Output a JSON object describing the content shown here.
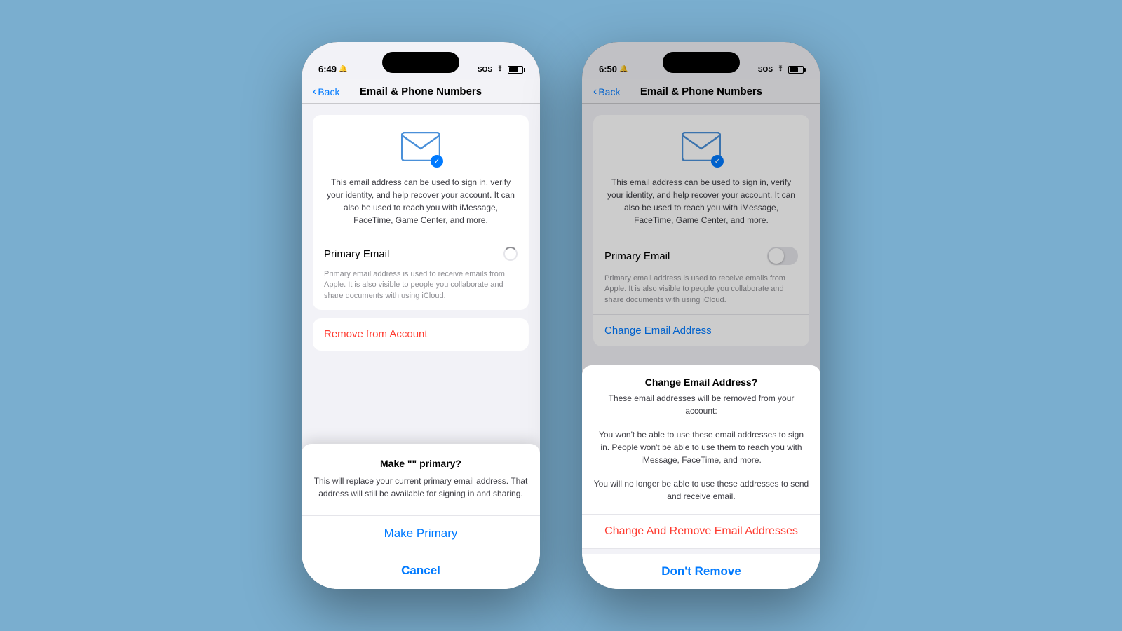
{
  "background_color": "#7aaecf",
  "phone_left": {
    "status": {
      "time": "6:49",
      "bell_icon": "🔔",
      "signal": "SOS",
      "wifi": true,
      "battery": 70
    },
    "nav": {
      "back_label": "Back",
      "title": "Email & Phone Numbers"
    },
    "card": {
      "description": "This email address can be used to sign in, verify your identity, and help recover your account. It can also be used to reach you with iMessage, FaceTime, Game Center, and more.",
      "primary_email_label": "Primary Email",
      "primary_email_sub": "Primary email address is used to receive emails from Apple. It is also visible to people you collaborate and share documents with using iCloud."
    },
    "remove_button": "Remove from Account",
    "sheet": {
      "title": "Make \"\" primary?",
      "body": "This will replace your current primary email address. That address will still be available for signing in and sharing.",
      "action_label": "Make Primary",
      "cancel_label": "Cancel"
    }
  },
  "phone_right": {
    "status": {
      "time": "6:50",
      "bell_icon": "🔔",
      "signal": "SOS",
      "wifi": true,
      "battery": 69
    },
    "nav": {
      "back_label": "Back",
      "title": "Email & Phone Numbers"
    },
    "card": {
      "description": "This email address can be used to sign in, verify your identity, and help recover your account. It can also be used to reach you with iMessage, FaceTime, Game Center, and more.",
      "primary_email_label": "Primary Email",
      "primary_email_sub": "Primary email address is used to receive emails from Apple. It is also visible to people you collaborate and share documents with using iCloud."
    },
    "change_email_link": "Change Email Address",
    "alert": {
      "title": "Change Email Address?",
      "body1": "These email addresses will be removed from your account:",
      "body2": "You won't be able to use these email addresses to sign in. People won't be able to use them to reach you with iMessage, FaceTime, and more.",
      "body3": "You will no longer be able to use these addresses to send and receive email.",
      "action_label": "Change And Remove Email Addresses",
      "cancel_label": "Don't Remove"
    }
  },
  "icons": {
    "envelope": "✉",
    "check": "✓",
    "chevron_left": "‹"
  }
}
